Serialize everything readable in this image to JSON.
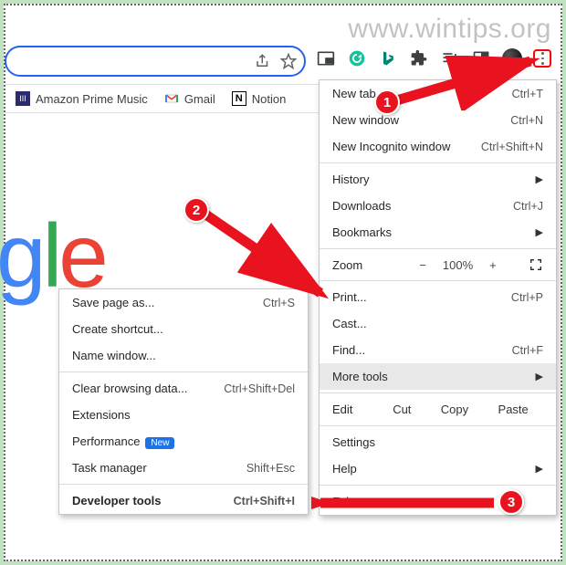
{
  "watermark": "www.wintips.org",
  "bookmarks": {
    "items": [
      {
        "label": "Amazon Prime Music"
      },
      {
        "label": "Gmail"
      },
      {
        "label": "Notion"
      }
    ]
  },
  "main_menu": {
    "new_tab": {
      "label": "New tab",
      "shortcut": "Ctrl+T"
    },
    "new_window": {
      "label": "New window",
      "shortcut": "Ctrl+N"
    },
    "new_incognito": {
      "label": "New Incognito window",
      "shortcut": "Ctrl+Shift+N"
    },
    "history": {
      "label": "History"
    },
    "downloads": {
      "label": "Downloads",
      "shortcut": "Ctrl+J"
    },
    "bookmarks": {
      "label": "Bookmarks"
    },
    "zoom": {
      "label": "Zoom",
      "value": "100%"
    },
    "print": {
      "label": "Print...",
      "shortcut": "Ctrl+P"
    },
    "cast": {
      "label": "Cast..."
    },
    "find": {
      "label": "Find...",
      "shortcut": "Ctrl+F"
    },
    "more_tools": {
      "label": "More tools"
    },
    "edit": {
      "label": "Edit",
      "cut": "Cut",
      "copy": "Copy",
      "paste": "Paste"
    },
    "settings": {
      "label": "Settings"
    },
    "help": {
      "label": "Help"
    },
    "exit": {
      "label": "Exit"
    }
  },
  "sub_menu": {
    "save_page": {
      "label": "Save page as...",
      "shortcut": "Ctrl+S"
    },
    "create_sc": {
      "label": "Create shortcut..."
    },
    "name_win": {
      "label": "Name window..."
    },
    "clear_data": {
      "label": "Clear browsing data...",
      "shortcut": "Ctrl+Shift+Del"
    },
    "extensions": {
      "label": "Extensions"
    },
    "performance": {
      "label": "Performance",
      "badge": "New"
    },
    "task_mgr": {
      "label": "Task manager",
      "shortcut": "Shift+Esc"
    },
    "dev_tools": {
      "label": "Developer tools",
      "shortcut": "Ctrl+Shift+I"
    }
  },
  "callouts": {
    "one": "1",
    "two": "2",
    "three": "3"
  }
}
